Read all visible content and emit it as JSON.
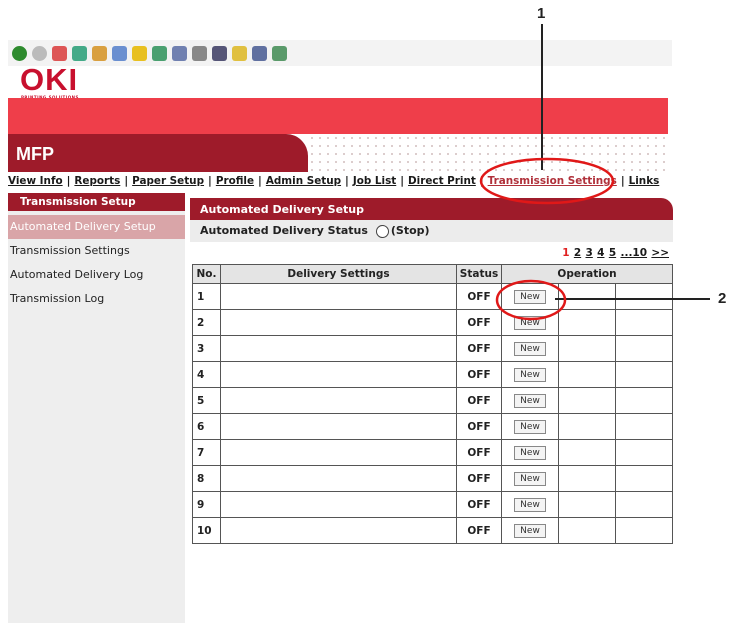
{
  "callouts": {
    "c1": "1",
    "c2": "2"
  },
  "toolbar": {
    "icons": [
      "back-icon",
      "forward-icon",
      "stop-icon",
      "refresh-icon",
      "home-icon",
      "search-icon",
      "favorites-icon",
      "history-icon",
      "mail-icon",
      "print-icon",
      "edit-icon",
      "discuss-icon",
      "messenger-icon",
      "research-icon"
    ]
  },
  "brand": {
    "logo": "OKI",
    "tagline": "PRINTING SOLUTIONS",
    "product": "MFP",
    "accent": "#ef3e4a",
    "dark": "#9e1b2a"
  },
  "nav": {
    "view_info": "View Info",
    "reports": "Reports",
    "paper_setup": "Paper Setup",
    "profile": "Profile",
    "admin_setup": "Admin Setup",
    "job_list": "Job List",
    "direct_print": "Direct Print",
    "transmission_settings": "Transmission Settings",
    "links": "Links",
    "sep": "|"
  },
  "sidebar": {
    "header": "Transmission Setup",
    "items": [
      "Automated Delivery Setup",
      "Transmission Settings",
      "Automated Delivery Log",
      "Transmission Log"
    ]
  },
  "main": {
    "panel_title": "Automated Delivery Setup",
    "status_label": "Automated Delivery Status",
    "status_value": "(Stop)",
    "pager": [
      "1",
      "2",
      "3",
      "4",
      "5",
      "...10",
      ">>"
    ],
    "columns": {
      "no": "No.",
      "settings": "Delivery Settings",
      "status": "Status",
      "operation": "Operation"
    },
    "rows": [
      {
        "no": "1",
        "status": "OFF",
        "button": "New"
      },
      {
        "no": "2",
        "status": "OFF",
        "button": "New"
      },
      {
        "no": "3",
        "status": "OFF",
        "button": "New"
      },
      {
        "no": "4",
        "status": "OFF",
        "button": "New"
      },
      {
        "no": "5",
        "status": "OFF",
        "button": "New"
      },
      {
        "no": "6",
        "status": "OFF",
        "button": "New"
      },
      {
        "no": "7",
        "status": "OFF",
        "button": "New"
      },
      {
        "no": "8",
        "status": "OFF",
        "button": "New"
      },
      {
        "no": "9",
        "status": "OFF",
        "button": "New"
      },
      {
        "no": "10",
        "status": "OFF",
        "button": "New"
      }
    ]
  }
}
